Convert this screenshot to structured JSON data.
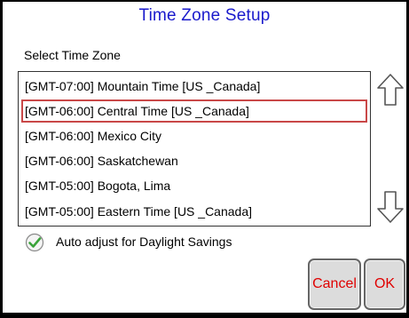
{
  "title": "Time Zone Setup",
  "section_label": "Select Time Zone",
  "time_zones": [
    {
      "label": "[GMT-07:00] Mountain Time [US _Canada]",
      "selected": false
    },
    {
      "label": "[GMT-06:00] Central Time [US _Canada]",
      "selected": true
    },
    {
      "label": "[GMT-06:00] Mexico City",
      "selected": false
    },
    {
      "label": "[GMT-06:00] Saskatchewan",
      "selected": false
    },
    {
      "label": "[GMT-05:00] Bogota, Lima",
      "selected": false
    },
    {
      "label": "[GMT-05:00] Eastern Time [US _Canada]",
      "selected": false
    }
  ],
  "icons": {
    "scroll_up": "arrow-up-icon",
    "scroll_down": "arrow-down-icon",
    "checkbox": "checkmark-icon"
  },
  "daylight_savings": {
    "label": "Auto adjust for Daylight Savings",
    "checked": true
  },
  "buttons": {
    "cancel": "Cancel",
    "ok": "OK"
  },
  "colors": {
    "title": "#1a1acc",
    "selection_border": "#c94848",
    "button_text": "#e00000",
    "check_green": "#3aa33a"
  }
}
